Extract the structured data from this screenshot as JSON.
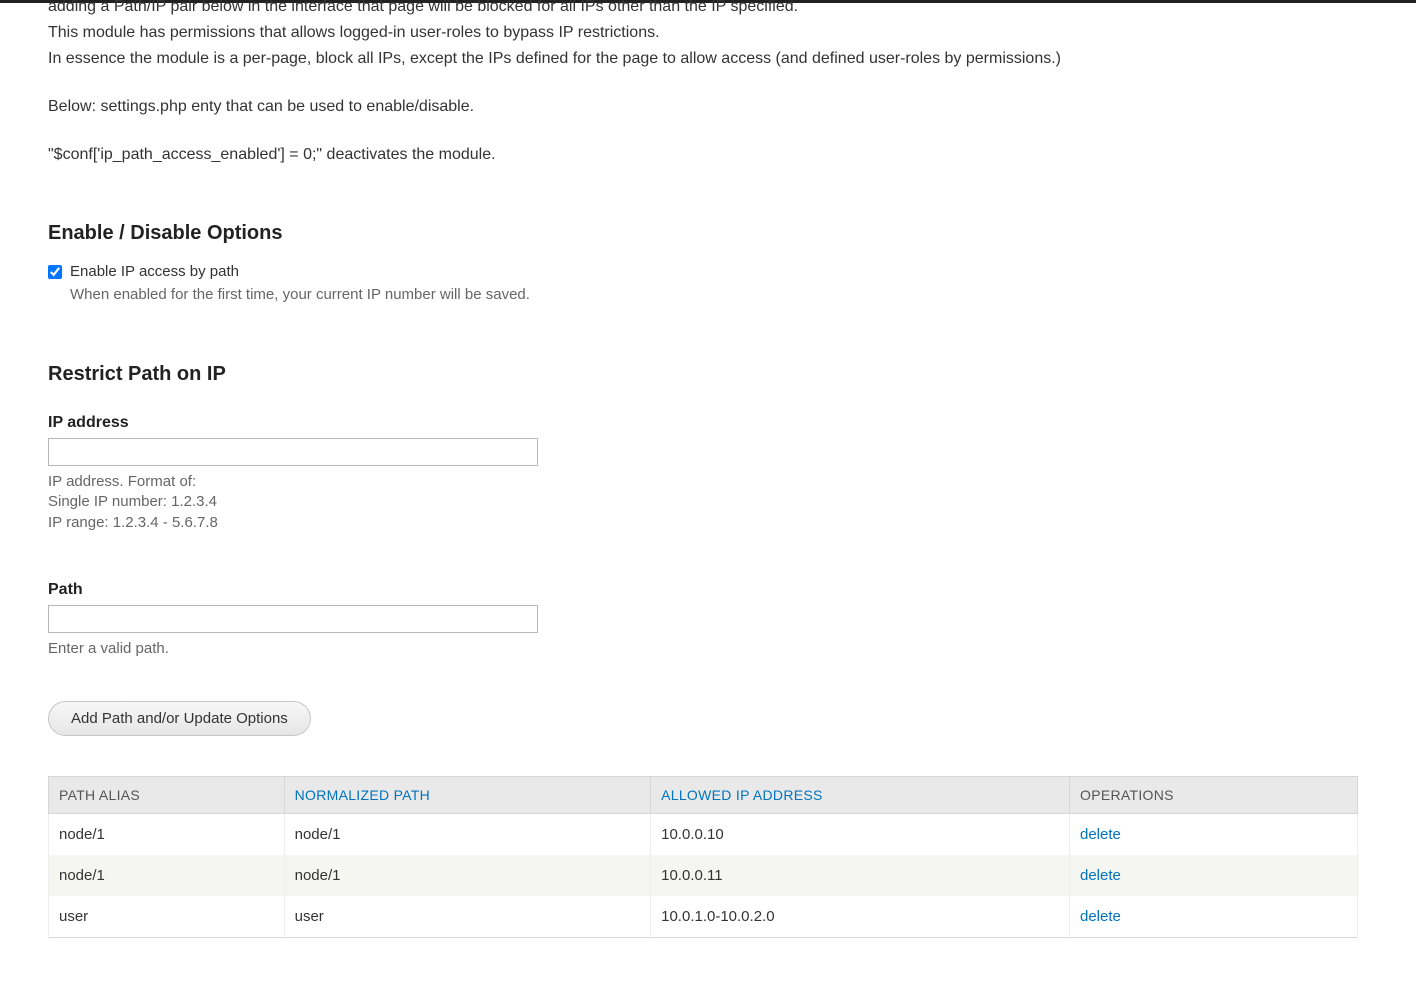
{
  "intro": {
    "line_cut": "adding a Path/IP pair below in the interface that page will be blocked for all IPs other than the IP specified.",
    "line1": "This module has permissions that allows logged-in user-roles to bypass IP restrictions.",
    "line2": "In essence the module is a per-page, block all IPs, except the IPs defined for the page to allow access (and defined user-roles by permissions.)",
    "line3": "Below: settings.php enty that can be used to enable/disable.",
    "line4": "\"$conf['ip_path_access_enabled'] = 0;\" deactivates the module."
  },
  "sections": {
    "enable_heading": "Enable / Disable Options",
    "restrict_heading": "Restrict Path on IP"
  },
  "enable": {
    "checkbox_label": "Enable IP access by path",
    "checkbox_checked": true,
    "help": "When enabled for the first time, your current IP number will be saved."
  },
  "ip_field": {
    "label": "IP address",
    "value": "",
    "help": "IP address. Format of:\nSingle IP number: 1.2.3.4\nIP range: 1.2.3.4 - 5.6.7.8"
  },
  "path_field": {
    "label": "Path",
    "value": "",
    "help": "Enter a valid path."
  },
  "submit_label": "Add Path and/or Update Options",
  "table": {
    "headers": {
      "alias": "PATH ALIAS",
      "normalized": "NORMALIZED PATH",
      "ip": "ALLOWED IP ADDRESS",
      "ops": "OPERATIONS"
    },
    "rows": [
      {
        "alias": "node/1",
        "normalized": "node/1",
        "ip": "10.0.0.10",
        "op": "delete"
      },
      {
        "alias": "node/1",
        "normalized": "node/1",
        "ip": "10.0.0.11",
        "op": "delete"
      },
      {
        "alias": "user",
        "normalized": "user",
        "ip": "10.0.1.0-10.0.2.0",
        "op": "delete"
      }
    ]
  }
}
